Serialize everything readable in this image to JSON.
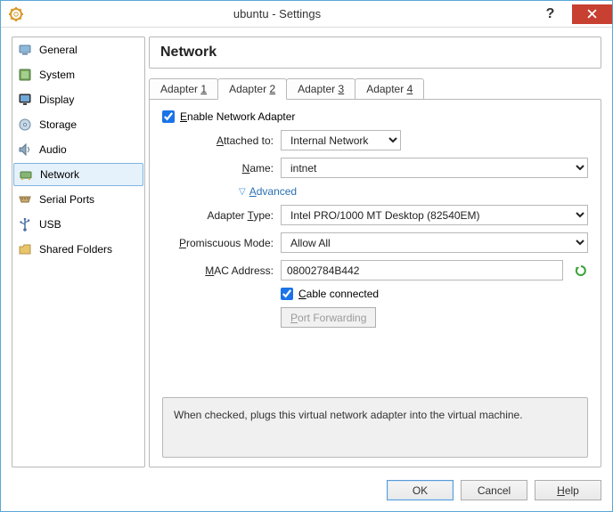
{
  "window": {
    "title": "ubuntu - Settings"
  },
  "sidebar": {
    "items": [
      {
        "label": "General"
      },
      {
        "label": "System"
      },
      {
        "label": "Display"
      },
      {
        "label": "Storage"
      },
      {
        "label": "Audio"
      },
      {
        "label": "Network"
      },
      {
        "label": "Serial Ports"
      },
      {
        "label": "USB"
      },
      {
        "label": "Shared Folders"
      }
    ]
  },
  "panel": {
    "heading": "Network"
  },
  "tabs": [
    {
      "prefix": "Adapter ",
      "num": "1"
    },
    {
      "prefix": "Adapter ",
      "num": "2"
    },
    {
      "prefix": "Adapter ",
      "num": "3"
    },
    {
      "prefix": "Adapter ",
      "num": "4"
    }
  ],
  "form": {
    "enable_label_pre": "E",
    "enable_label_post": "nable Network Adapter",
    "enable_checked": true,
    "attached_label_pre": "A",
    "attached_label_post": "ttached to:",
    "attached_value": "Internal Network",
    "name_label_pre": "N",
    "name_label_post": "ame:",
    "name_value": "intnet",
    "advanced_label_pre": "A",
    "advanced_label_post": "dvanced",
    "adapter_type_label_pre": "Adapter ",
    "adapter_type_label_u": "T",
    "adapter_type_label_post": "ype:",
    "adapter_type_value": "Intel PRO/1000 MT Desktop (82540EM)",
    "promiscuous_label_pre": "P",
    "promiscuous_label_post": "romiscuous Mode:",
    "promiscuous_value": "Allow All",
    "mac_label_pre": "M",
    "mac_label_post": "AC Address:",
    "mac_value": "08002784B442",
    "cable_label_pre": "C",
    "cable_label_post": "able connected",
    "cable_checked": true,
    "port_forwarding_label_pre": "P",
    "port_forwarding_label_post": "ort Forwarding"
  },
  "hint": "When checked, plugs this virtual network adapter into the virtual machine.",
  "buttons": {
    "ok": "OK",
    "cancel": "Cancel",
    "help_pre": "H",
    "help_post": "elp"
  }
}
